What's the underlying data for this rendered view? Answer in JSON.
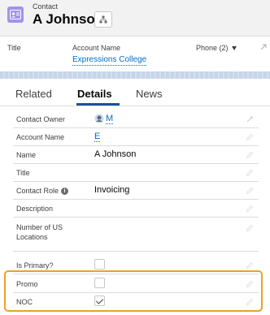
{
  "header": {
    "record_type": "Contact",
    "record_name": "A Johnson",
    "icon": "contact-card-icon",
    "hierarchy_icon": "hierarchy-icon"
  },
  "highlights": {
    "title_label": "Title",
    "account_label": "Account Name",
    "account_value": "Expressions College",
    "phone_label": "Phone (2)"
  },
  "tabs": [
    {
      "label": "Related",
      "active": false
    },
    {
      "label": "Details",
      "active": true
    },
    {
      "label": "News",
      "active": false
    }
  ],
  "fields": {
    "contact_owner": {
      "label": "Contact Owner",
      "value": "M"
    },
    "account_name": {
      "label": "Account Name",
      "value": "E"
    },
    "name": {
      "label": "Name",
      "value": "A Johnson"
    },
    "title": {
      "label": "Title",
      "value": ""
    },
    "contact_role": {
      "label": "Contact Role",
      "value": "Invoicing"
    },
    "description": {
      "label": "Description",
      "value": ""
    },
    "locations": {
      "label": "Number of US Locations",
      "value": ""
    },
    "is_primary": {
      "label": "Is Primary?",
      "checked": false
    },
    "promo": {
      "label": "Promo",
      "checked": false
    },
    "noc": {
      "label": "NOC",
      "checked": true
    }
  },
  "colors": {
    "accent": "#006dcc",
    "highlight_border": "#e9a321",
    "contact_icon_bg": "#a094ed",
    "tab_underline": "#1b5297"
  }
}
